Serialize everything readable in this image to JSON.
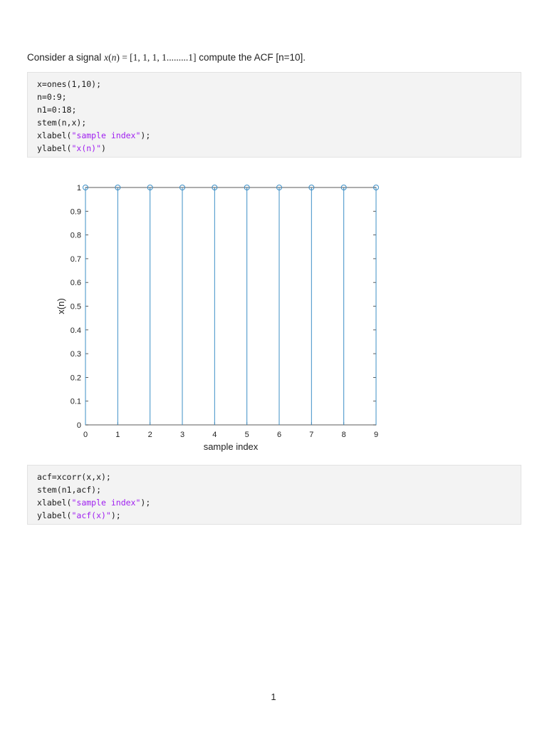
{
  "problem": {
    "prefix": "Consider a signal ",
    "math_func": "x",
    "math_var": "n",
    "math_seq": " = [1, 1, 1, 1.........1]",
    "suffix": " compute the ACF [n=10]."
  },
  "code_blocks": [
    {
      "lines": [
        [
          {
            "t": "x=ones(1,10);"
          }
        ],
        [
          {
            "t": "n=0:9;"
          }
        ],
        [
          {
            "t": "n1=0:18;"
          }
        ],
        [
          {
            "t": "stem(n,x);"
          }
        ],
        [
          {
            "t": "xlabel("
          },
          {
            "t": "\"sample index\"",
            "s": true
          },
          {
            "t": ");"
          }
        ],
        [
          {
            "t": "ylabel("
          },
          {
            "t": "\"x(n)\"",
            "s": true
          },
          {
            "t": ")"
          }
        ]
      ]
    },
    {
      "lines": [
        [
          {
            "t": "acf=xcorr(x,x);"
          }
        ],
        [
          {
            "t": "stem(n1,acf);"
          }
        ],
        [
          {
            "t": "xlabel("
          },
          {
            "t": "\"sample index\"",
            "s": true
          },
          {
            "t": ");"
          }
        ],
        [
          {
            "t": "ylabel("
          },
          {
            "t": "\"acf(x)\"",
            "s": true
          },
          {
            "t": ");"
          }
        ]
      ]
    }
  ],
  "colors": {
    "stem": "#3d8fc6",
    "string": "#a020f0",
    "axis": "#333333"
  },
  "chart_data": {
    "type": "stem",
    "x": [
      0,
      1,
      2,
      3,
      4,
      5,
      6,
      7,
      8,
      9
    ],
    "y": [
      1,
      1,
      1,
      1,
      1,
      1,
      1,
      1,
      1,
      1
    ],
    "xlabel": "sample index",
    "ylabel": "x(n)",
    "xlim": [
      0,
      9
    ],
    "ylim": [
      0,
      1
    ],
    "xticks": [
      "0",
      "1",
      "2",
      "3",
      "4",
      "5",
      "6",
      "7",
      "8",
      "9"
    ],
    "yticks": [
      "0",
      "0.1",
      "0.2",
      "0.3",
      "0.4",
      "0.5",
      "0.6",
      "0.7",
      "0.8",
      "0.9",
      "1"
    ],
    "grid": false,
    "marker": "circle"
  },
  "page_number": "1"
}
